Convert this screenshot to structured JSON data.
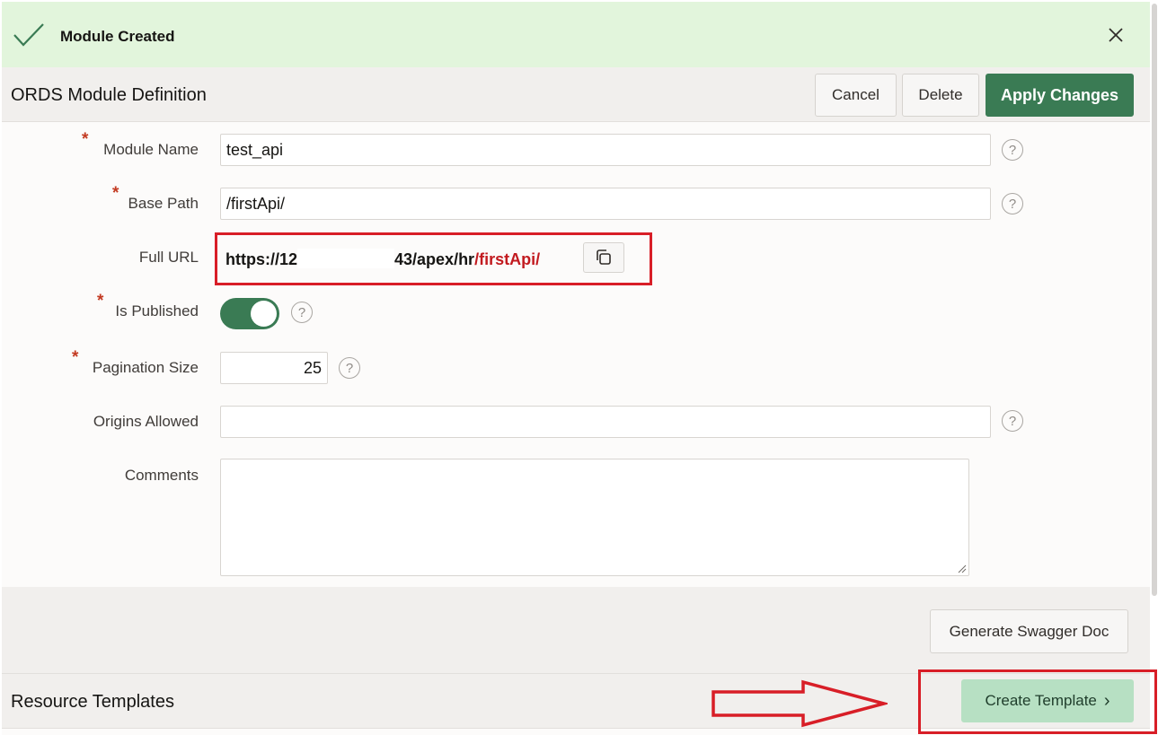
{
  "banner": {
    "message": "Module Created"
  },
  "region": {
    "title": "ORDS Module Definition",
    "buttons": {
      "cancel": "Cancel",
      "delete": "Delete",
      "apply": "Apply Changes"
    }
  },
  "form": {
    "module_name": {
      "label": "Module Name",
      "value": "test_api"
    },
    "base_path": {
      "label": "Base Path",
      "value": "/firstApi/"
    },
    "full_url": {
      "label": "Full URL",
      "prefix": "https://12",
      "middle": "43/apex/hr",
      "suffix": "/firstApi/"
    },
    "is_published": {
      "label": "Is Published",
      "value": true
    },
    "pagination_size": {
      "label": "Pagination Size",
      "value": "25"
    },
    "origins_allowed": {
      "label": "Origins Allowed",
      "value": ""
    },
    "comments": {
      "label": "Comments",
      "value": ""
    },
    "help_glyph": "?"
  },
  "swagger": {
    "label": "Generate Swagger Doc"
  },
  "resource_templates": {
    "title": "Resource Templates",
    "create_button": "Create Template",
    "create_chevron": "›"
  },
  "colors": {
    "accent_green": "#3a7b54",
    "annotation_red": "#d81e27",
    "banner_bg": "#e2f5dc"
  }
}
